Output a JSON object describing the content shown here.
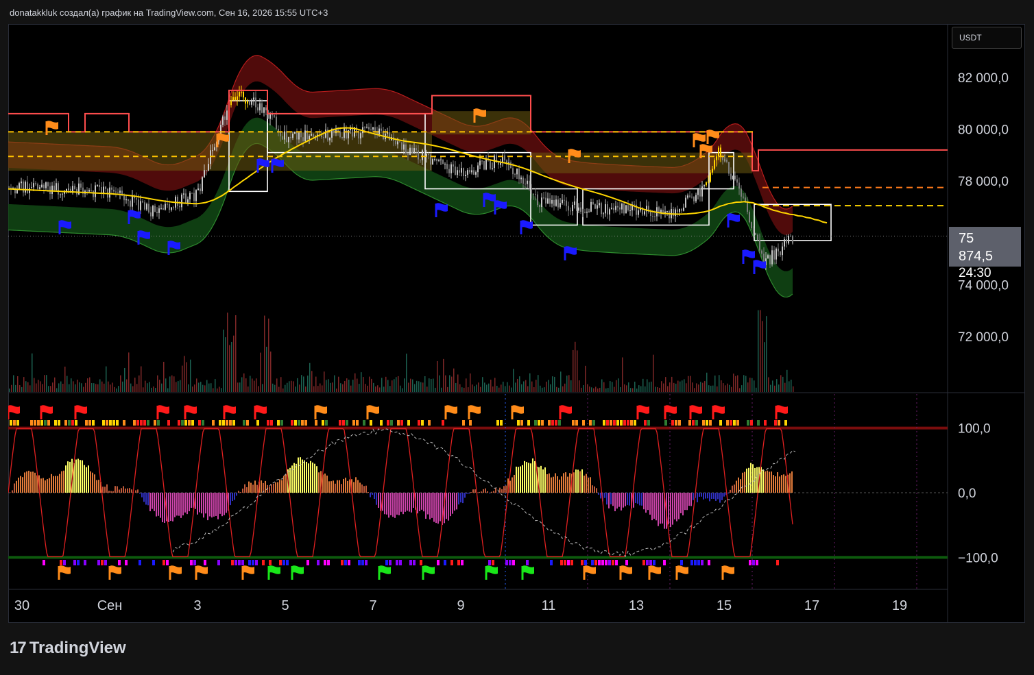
{
  "header": {
    "attribution": "donatakkluk создал(а) график на TradingView.com, Сен 16, 2026 15:55 UTC+3"
  },
  "currency": "USDT",
  "last_price": {
    "price": "75 874,5",
    "countdown": "24:30"
  },
  "brand": {
    "name": "TradingView",
    "logo": "17"
  },
  "colors": {
    "background": "#000000",
    "upper_band": "#b71c1c",
    "lower_band": "#1b5e20",
    "ma": "#ffd600",
    "resistance": "#ff4d4d",
    "flag_red": "#ff1a1a",
    "flag_orange": "#ff8c1a",
    "flag_blue": "#1a1aff",
    "flag_green": "#19e619",
    "oscillator": "#e02020"
  },
  "price_axis": {
    "labels": [
      "82 000,0",
      "80 000,0",
      "78 000,0",
      "74 000,0",
      "72 000,0"
    ],
    "values": [
      82000,
      80000,
      78000,
      74000,
      72000
    ]
  },
  "osc_axis": {
    "labels": [
      "100,0",
      "0,0",
      "−100,0"
    ],
    "values": [
      100,
      0,
      -100
    ]
  },
  "time_axis": {
    "labels": [
      "30",
      "Сен",
      "3",
      "5",
      "7",
      "9",
      "11",
      "13",
      "15",
      "17",
      "19"
    ]
  },
  "chart_data": {
    "type": "candlestick",
    "symbol_quote": "USDT",
    "ylim": [
      70000,
      84000
    ],
    "last_value": 75874.5,
    "close_trend": [
      {
        "x": "Авг 30",
        "y": 78000
      },
      {
        "x": "Сен 1",
        "y": 77600
      },
      {
        "x": "Сен 2",
        "y": 76800
      },
      {
        "x": "Сен 3",
        "y": 77500
      },
      {
        "x": "Сен 3.8",
        "y": 81400
      },
      {
        "x": "Сен 4.5",
        "y": 80800
      },
      {
        "x": "Сен 5",
        "y": 79700
      },
      {
        "x": "Сен 6",
        "y": 79800
      },
      {
        "x": "Сен 7",
        "y": 79900
      },
      {
        "x": "Сен 8",
        "y": 79100
      },
      {
        "x": "Сен 9",
        "y": 78300
      },
      {
        "x": "Сен 10",
        "y": 78900
      },
      {
        "x": "Сен 10.8",
        "y": 77200
      },
      {
        "x": "Сен 11.5",
        "y": 77000
      },
      {
        "x": "Сен 12.5",
        "y": 76900
      },
      {
        "x": "Сен 13.8",
        "y": 76800
      },
      {
        "x": "Сен 14.6",
        "y": 77800
      },
      {
        "x": "Сен 14.9",
        "y": 79200
      },
      {
        "x": "Сен 15.5",
        "y": 77100
      },
      {
        "x": "Сен 15.9",
        "y": 74800
      },
      {
        "x": "Сен 16.6",
        "y": 75874.5
      }
    ],
    "oscillator": {
      "ylim": [
        -100,
        100
      ],
      "levels": [
        100,
        0,
        -100
      ]
    }
  }
}
